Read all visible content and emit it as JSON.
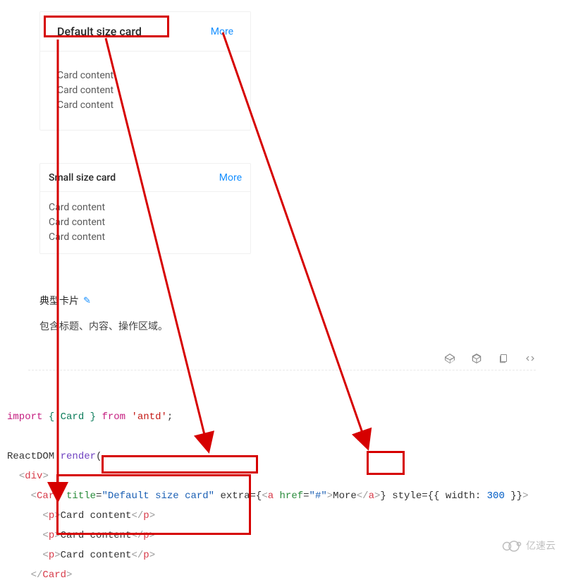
{
  "cards": [
    {
      "title": "Default size card",
      "extra": "More",
      "body": [
        "Card content",
        "Card content",
        "Card content"
      ],
      "size": "default"
    },
    {
      "title": "Small size card",
      "extra": "More",
      "body": [
        "Card content",
        "Card content",
        "Card content"
      ],
      "size": "small"
    }
  ],
  "doc": {
    "title": "典型卡片",
    "edit_icon_label": "✎",
    "description": "包含标题、内容、操作区域。"
  },
  "toolbar_icons": [
    "codepen-icon",
    "codesandbox-icon",
    "copy-icon",
    "code-icon"
  ],
  "code": {
    "import_kw": "import",
    "import_names": "{ Card }",
    "from_kw": "from",
    "import_src": "'antd'",
    "reactdom": "ReactDOM",
    "render": ".render",
    "open_paren": "(",
    "div_open": "<div>",
    "card_open_prefix": "<Card ",
    "title_attr": "title",
    "title_val": "\"Default size card\"",
    "extra_attr": " extra={",
    "a_open": "<a ",
    "href_attr": "href",
    "href_val": "\"#\"",
    "a_content": "More",
    "a_close": "</a>",
    "extra_close": "}",
    "style_attr": " style={{ ",
    "width_key": "width",
    "width_colon_space": ": ",
    "width_val": "300",
    "style_close": " }}",
    "p_open": "<p>",
    "p_text": "Card content",
    "p_close": "</p>",
    "card_close": "</Card>"
  },
  "watermark": "亿速云"
}
